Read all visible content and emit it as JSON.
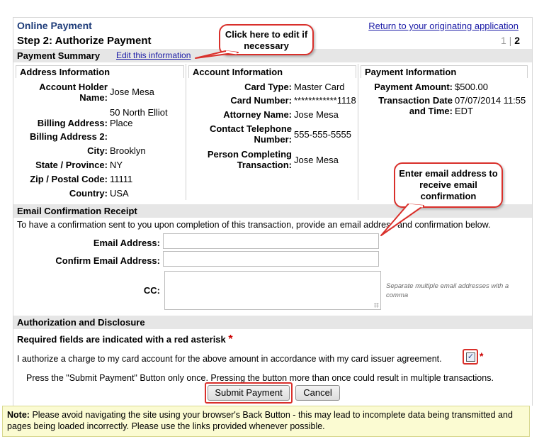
{
  "header": {
    "app_title": "Online Payment",
    "return_link": "Return to your originating application",
    "step_title": "Step 2: Authorize Payment",
    "step_prev": "1",
    "step_sep": "|",
    "step_current": "2"
  },
  "summary": {
    "title": "Payment Summary",
    "edit_link": "Edit this information"
  },
  "address": {
    "heading": "Address Information",
    "account_holder_label": "Account Holder Name:",
    "account_holder_value": "Jose Mesa",
    "billing_address_label": "Billing Address:",
    "billing_address_value": "50 North Elliot Place",
    "billing_address2_label": "Billing Address 2:",
    "billing_address2_value": "",
    "city_label": "City:",
    "city_value": "Brooklyn",
    "state_label": "State / Province:",
    "state_value": "NY",
    "zip_label": "Zip / Postal Code:",
    "zip_value": "11111",
    "country_label": "Country:",
    "country_value": "USA"
  },
  "account": {
    "heading": "Account Information",
    "card_type_label": "Card Type:",
    "card_type_value": "Master Card",
    "card_number_label": "Card Number:",
    "card_number_value": "************1118",
    "attorney_label": "Attorney Name:",
    "attorney_value": "Jose Mesa",
    "phone_label": "Contact Telephone Number:",
    "phone_value": "555-555-5555",
    "person_label": "Person Completing Transaction:",
    "person_value": "Jose Mesa"
  },
  "payment": {
    "heading": "Payment Information",
    "amount_label": "Payment Amount:",
    "amount_value": "$500.00",
    "date_label": "Transaction Date and Time:",
    "date_value": "07/07/2014 11:55 EDT"
  },
  "email": {
    "section_title": "Email Confirmation Receipt",
    "instructions": "To have a confirmation sent to you upon completion of this transaction, provide an email address and confirmation below.",
    "email_label": "Email Address:",
    "email_value": "",
    "confirm_label": "Confirm Email Address:",
    "confirm_value": "",
    "cc_label": "CC:",
    "cc_value": "",
    "cc_hint": "Separate multiple email addresses with a comma"
  },
  "authorization": {
    "section_title": "Authorization and Disclosure",
    "required_note": "Required fields are indicated with a red asterisk",
    "asterisk": "*",
    "authorize_text": "I authorize a charge to my card account for the above amount in accordance with my card issuer agreement.",
    "authorize_checked": true,
    "checkmark": "✓",
    "press_once": "Press the \"Submit Payment\" Button only once. Pressing the button more than once could result in multiple transactions.",
    "submit_label": "Submit Payment",
    "cancel_label": "Cancel"
  },
  "note": {
    "label": "Note:",
    "text": "Please avoid navigating the site using your browser's Back Button - this may lead to incomplete data being transmitted and pages being loaded incorrectly. Please use the links provided whenever possible."
  },
  "callouts": {
    "edit": "Click here to edit if necessary",
    "email": "Enter email address to receive email confirmation"
  },
  "colors": {
    "callout_border": "#d9302b",
    "link": "#1a1aa6",
    "title": "#1f3d7a",
    "section_bg": "#e6e6e6",
    "note_bg": "#fbfbd2"
  }
}
